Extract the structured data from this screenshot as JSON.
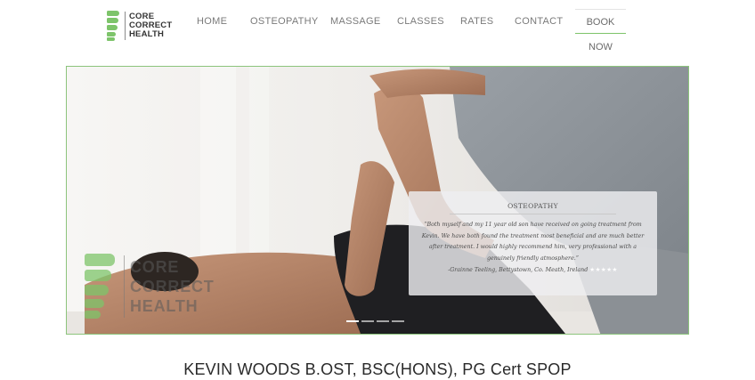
{
  "logo": {
    "line1": "CORE",
    "line2": "CORRECT",
    "line3": "HEALTH"
  },
  "nav": {
    "items": [
      "HOME",
      "OSTEOPATHY",
      "MASSAGE",
      "CLASSES",
      "RATES",
      "CONTACT"
    ],
    "book_label": "BOOK NOW"
  },
  "hero": {
    "testimonial": {
      "title": "OSTEOPATHY",
      "quote": "“Both myself and my 11 year old son have received on going treatment from Kevin. We have both found the treatment most beneficial and are much better after treatment. I would highly recommend him, very professional with a genuinely friendly atmosphere.”",
      "author": "-Grainne Teeling, Bettystown, Co. Meath, Ireland",
      "stars": "★★★★★",
      "rating": 5
    },
    "slides": 4,
    "active_slide": 1,
    "watermark": {
      "line1": "CORE",
      "line2": "CORRECT",
      "line3": "HEALTH"
    }
  },
  "headline": "KEVIN WOODS B.OST, BSC(HONS), PG Cert SPOP",
  "colors": {
    "brand_green": "#7dc46a",
    "nav_text": "#7a7a7a",
    "headline": "#2a2a2a"
  }
}
